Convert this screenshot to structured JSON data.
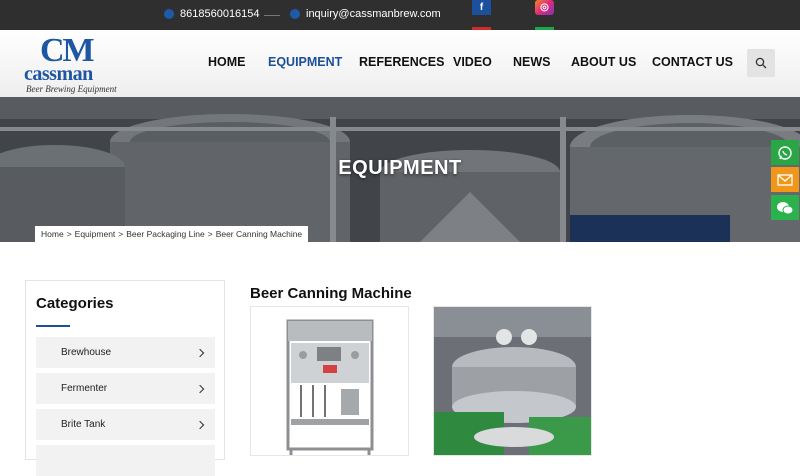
{
  "topbar": {
    "phone": "8618560016154",
    "email": "inquiry@cassmanbrew.com",
    "social": [
      {
        "name": "facebook",
        "glyph": "f"
      },
      {
        "name": "instagram",
        "glyph": "◎"
      }
    ]
  },
  "logo": {
    "mark": "CM",
    "name": "cassman",
    "tagline": "Beer Brewing Equipment"
  },
  "nav": {
    "items": [
      {
        "label": "HOME",
        "active": false
      },
      {
        "label": "EQUIPMENT",
        "active": true
      },
      {
        "label": "REFERENCES",
        "active": false
      },
      {
        "label": "VIDEO",
        "active": false
      },
      {
        "label": "NEWS",
        "active": false
      },
      {
        "label": "ABOUT US",
        "active": false
      },
      {
        "label": "CONTACT US",
        "active": false
      }
    ],
    "search_icon": "search-icon"
  },
  "banner": {
    "title": "EQUIPMENT",
    "breadcrumb": [
      "Home",
      "Equipment",
      "Beer Packaging Line",
      "Beer Canning Machine"
    ],
    "separator": ">"
  },
  "floating": [
    "whatsapp-icon",
    "email-icon",
    "wechat-icon"
  ],
  "sidebar": {
    "title": "Categories",
    "items": [
      "Brewhouse",
      "Fermenter",
      "Brite Tank"
    ]
  },
  "main": {
    "title": "Beer Canning Machine",
    "products": [
      {
        "image": "semi-automatic canning machine"
      },
      {
        "image": "rotary canning machine"
      }
    ]
  },
  "colors": {
    "brand": "#1d56a3",
    "nav_active": "#1d4f98",
    "topbar": "#2f2f2f",
    "whatsapp": "#29a745",
    "email": "#f0971a",
    "wechat": "#2bb24c"
  }
}
